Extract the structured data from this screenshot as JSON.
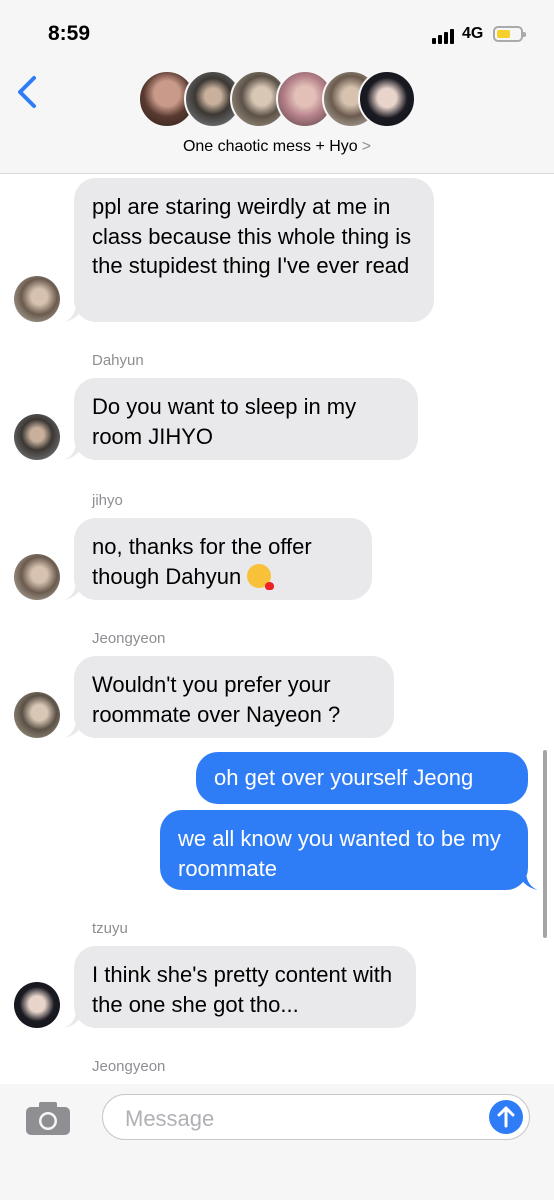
{
  "status": {
    "time": "8:59",
    "network": "4G"
  },
  "header": {
    "title": "One chaotic mess + Hyo",
    "chevron": ">"
  },
  "messages": [
    {
      "text": "ppl are staring weirdly at me in class because this whole thing is the stupidest thing I've ever read"
    },
    {
      "sender": "Dahyun",
      "text": "Do you want to sleep in my room JIHYO"
    },
    {
      "sender": "jihyo",
      "text": "no, thanks for the offer though Dahyun",
      "emoji": "kissing-heart-emoji"
    },
    {
      "sender": "Jeongyeon",
      "text": "Wouldn't you prefer your roommate over Nayeon ?"
    },
    {
      "text": "oh get over yourself Jeong"
    },
    {
      "text": "we all know you wanted to be my roommate"
    },
    {
      "sender": "tzuyu",
      "text": "I think she's pretty content with the one she got tho..."
    },
    {
      "sender": "Jeongyeon"
    }
  ],
  "composer": {
    "placeholder": "Message"
  },
  "colors": {
    "outgoing": "#2f7df6",
    "incoming": "#e9e9eb",
    "accent": "#2f7df6"
  },
  "icons": [
    "back-chevron-icon",
    "camera-icon",
    "send-arrow-icon",
    "signal-icon",
    "battery-icon"
  ]
}
